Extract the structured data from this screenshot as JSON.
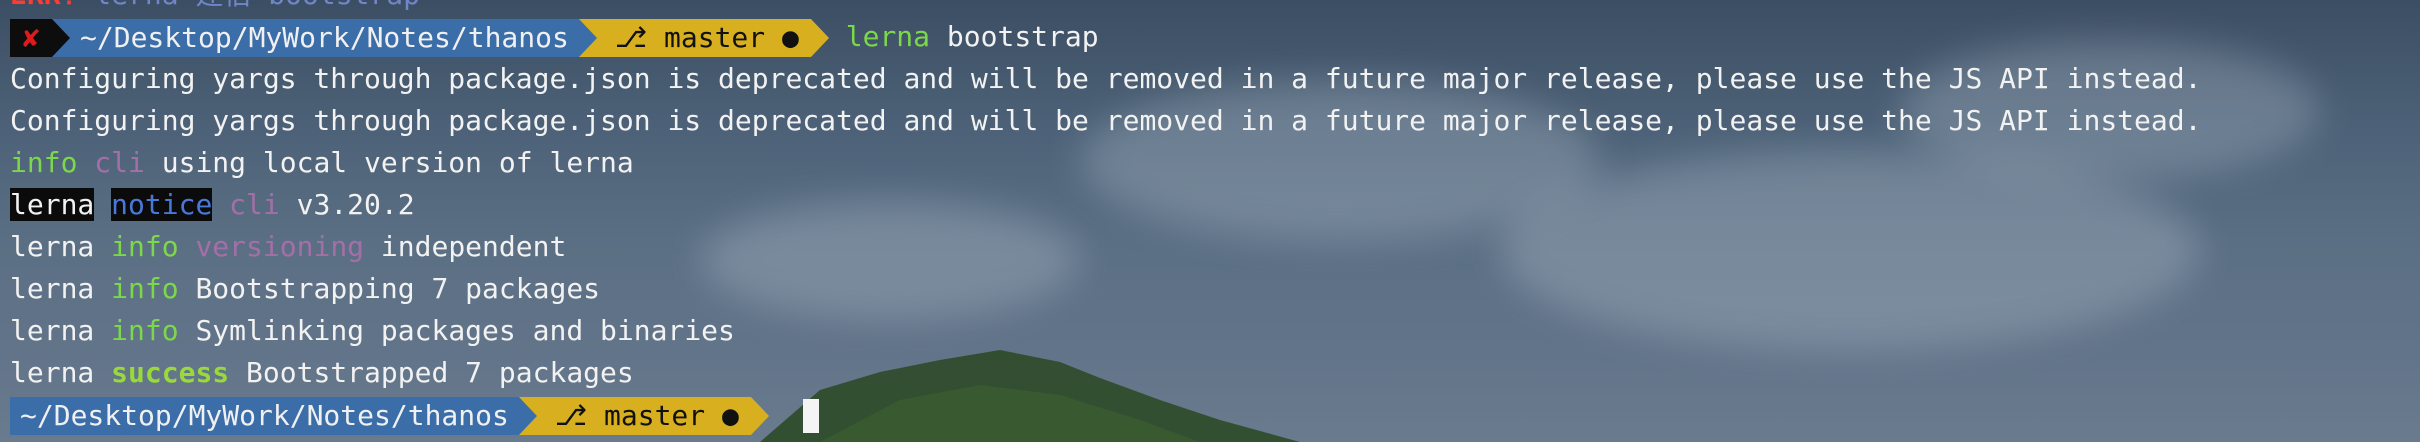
{
  "prev_line": {
    "err": "ERR!",
    "cmd": "lerna 建宿 bootstrap"
  },
  "prompt1": {
    "status_icon": "✘",
    "path": "~/Desktop/MyWork/Notes/thanos",
    "branch_icon": "⎇",
    "branch": "master",
    "dirty_dot": "●",
    "cmd_tool": "lerna",
    "cmd_arg": "bootstrap"
  },
  "output": {
    "warning1": "Configuring yargs through package.json is deprecated and will be removed in a future major release, please use the JS API instead.",
    "warning2": "Configuring yargs through package.json is deprecated and will be removed in a future major release, please use the JS API instead.",
    "info_line": {
      "level": "info",
      "tag": "cli",
      "text": "using local version of lerna"
    },
    "notice_line": {
      "prefix": "lerna",
      "level": "notice",
      "tag": "cli",
      "text": "v3.20.2"
    },
    "versioning_line": {
      "prefix": "lerna",
      "level": "info",
      "tag": "versioning",
      "text": "independent"
    },
    "bootstrap_line": {
      "prefix": "lerna",
      "level": "info",
      "text": "Bootstrapping 7 packages"
    },
    "symlink_line": {
      "prefix": "lerna",
      "level": "info",
      "text": "Symlinking packages and binaries"
    },
    "success_line": {
      "prefix": "lerna",
      "level": "success",
      "text": "Bootstrapped 7 packages"
    }
  },
  "prompt2": {
    "path": "~/Desktop/MyWork/Notes/thanos",
    "branch_icon": "⎇",
    "branch": "master",
    "dirty_dot": "●"
  },
  "colors": {
    "path_segment": "#3b6ea8",
    "branch_segment": "#d8b01f",
    "error_segment": "#0d0d0d",
    "info": "#7bd84a",
    "notice": "#4a78d8",
    "tag": "#a46fa8"
  }
}
